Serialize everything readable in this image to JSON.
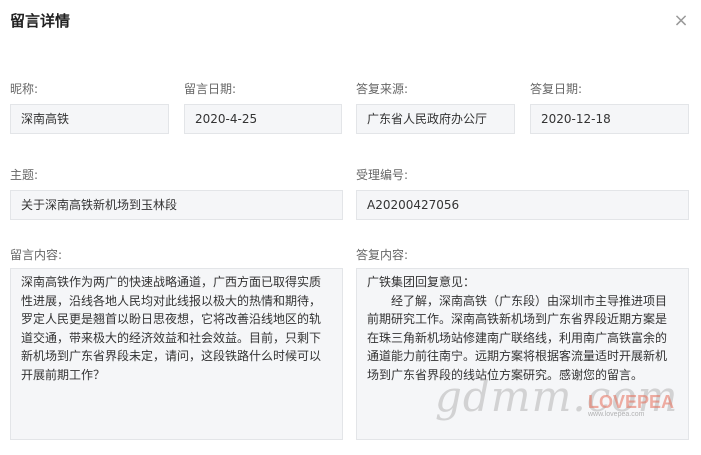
{
  "dialog": {
    "title": "留言详情",
    "close_glyph": "×"
  },
  "fields": {
    "nickname": {
      "label": "昵称:",
      "value": "深南高铁"
    },
    "message_date": {
      "label": "留言日期:",
      "value": "2020-4-25"
    },
    "reply_source": {
      "label": "答复来源:",
      "value": "广东省人民政府办公厅"
    },
    "reply_date": {
      "label": "答复日期:",
      "value": "2020-12-18"
    },
    "subject": {
      "label": "主题:",
      "value": "关于深南高铁新机场到玉林段"
    },
    "case_number": {
      "label": "受理编号:",
      "value": "A20200427056"
    }
  },
  "message": {
    "label": "留言内容:",
    "text": "深南高铁作为两广的快速战略通道，广西方面已取得实质性进展，沿线各地人民均对此线报以极大的热情和期待，罗定人民更是翘首以盼日思夜想，它将改善沿线地区的轨道交通，带来极大的经济效益和社会效益。目前，只剩下新机场到广东省界段未定，请问，这段铁路什么时候可以开展前期工作？"
  },
  "reply": {
    "label": "答复内容:",
    "heading": "广铁集团回复意见：",
    "text": "经了解，深南高铁（广东段）由深圳市主导推进项目前期研究工作。深南高铁新机场到广东省界段近期方案是在珠三角新机场站修建南广联络线，利用南广高铁富余的通道能力前往南宁。远期方案将根据客流量适时开展新机场到广东省界段的线站位方案研究。感谢您的留言。"
  },
  "watermarks": {
    "primary": "gdmm.com",
    "secondary": "LOVEPEA",
    "secondary_site": "www.lovepea.com"
  }
}
